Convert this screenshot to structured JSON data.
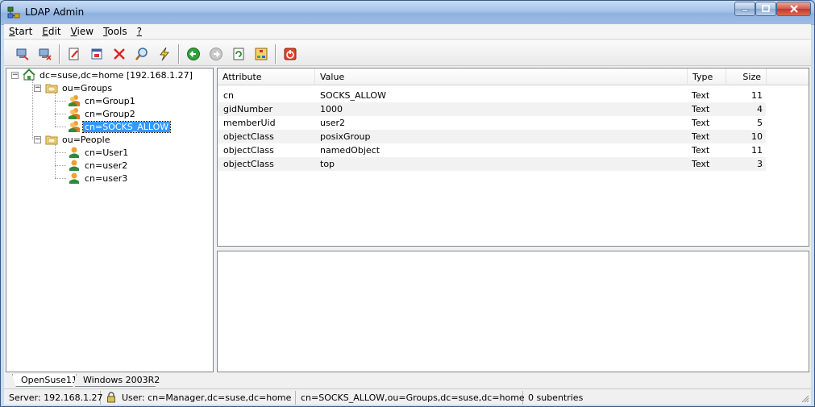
{
  "window": {
    "title": "LDAP Admin",
    "controls": {
      "minimize": "–",
      "maximize": "□",
      "close": "✕"
    }
  },
  "menu": [
    "Start",
    "Edit",
    "View",
    "Tools",
    "?"
  ],
  "menu_underline": [
    "S",
    "E",
    "V",
    "T",
    "?"
  ],
  "menu_rest": [
    "tart",
    "dit",
    "iew",
    "ools",
    ""
  ],
  "toolbar": {
    "buttons": [
      {
        "icon": "connect-icon"
      },
      {
        "icon": "disconnect-icon"
      },
      {
        "icon": "edit-entry-icon"
      },
      {
        "icon": "properties-icon"
      },
      {
        "icon": "delete-icon"
      },
      {
        "icon": "search-icon"
      },
      {
        "icon": "modify-icon"
      },
      {
        "icon": "back-icon"
      },
      {
        "icon": "forward-icon"
      },
      {
        "icon": "refresh-icon"
      },
      {
        "icon": "schema-icon"
      },
      {
        "icon": "exit-icon"
      }
    ]
  },
  "tree": {
    "root": "dc=suse,dc=home [192.168.1.27]",
    "groups": "ou=Groups",
    "group_items": [
      "cn=Group1",
      "cn=Group2",
      "cn=SOCKS_ALLOW"
    ],
    "people": "ou=People",
    "people_items": [
      "cn=User1",
      "cn=user2",
      "cn=user3"
    ],
    "expander_minus": "−"
  },
  "grid": {
    "columns": [
      "Attribute",
      "Value",
      "Type",
      "Size"
    ],
    "rows": [
      {
        "attribute": "cn",
        "value": "SOCKS_ALLOW",
        "type": "Text",
        "size": "11"
      },
      {
        "attribute": "gidNumber",
        "value": "1000",
        "type": "Text",
        "size": "4"
      },
      {
        "attribute": "memberUid",
        "value": "user2",
        "type": "Text",
        "size": "5"
      },
      {
        "attribute": "objectClass",
        "value": "posixGroup",
        "type": "Text",
        "size": "10"
      },
      {
        "attribute": "objectClass",
        "value": "namedObject",
        "type": "Text",
        "size": "11"
      },
      {
        "attribute": "objectClass",
        "value": "top",
        "type": "Text",
        "size": "3"
      }
    ]
  },
  "tabs": [
    "OpenSuse11",
    "Windows 2003R2"
  ],
  "status": {
    "server": "Server: 192.168.1.27",
    "user": "User: cn=Manager,dc=suse,dc=home",
    "dn": "cn=SOCKS_ALLOW,ou=Groups,dc=suse,dc=home",
    "subentries": "0 subentries"
  }
}
